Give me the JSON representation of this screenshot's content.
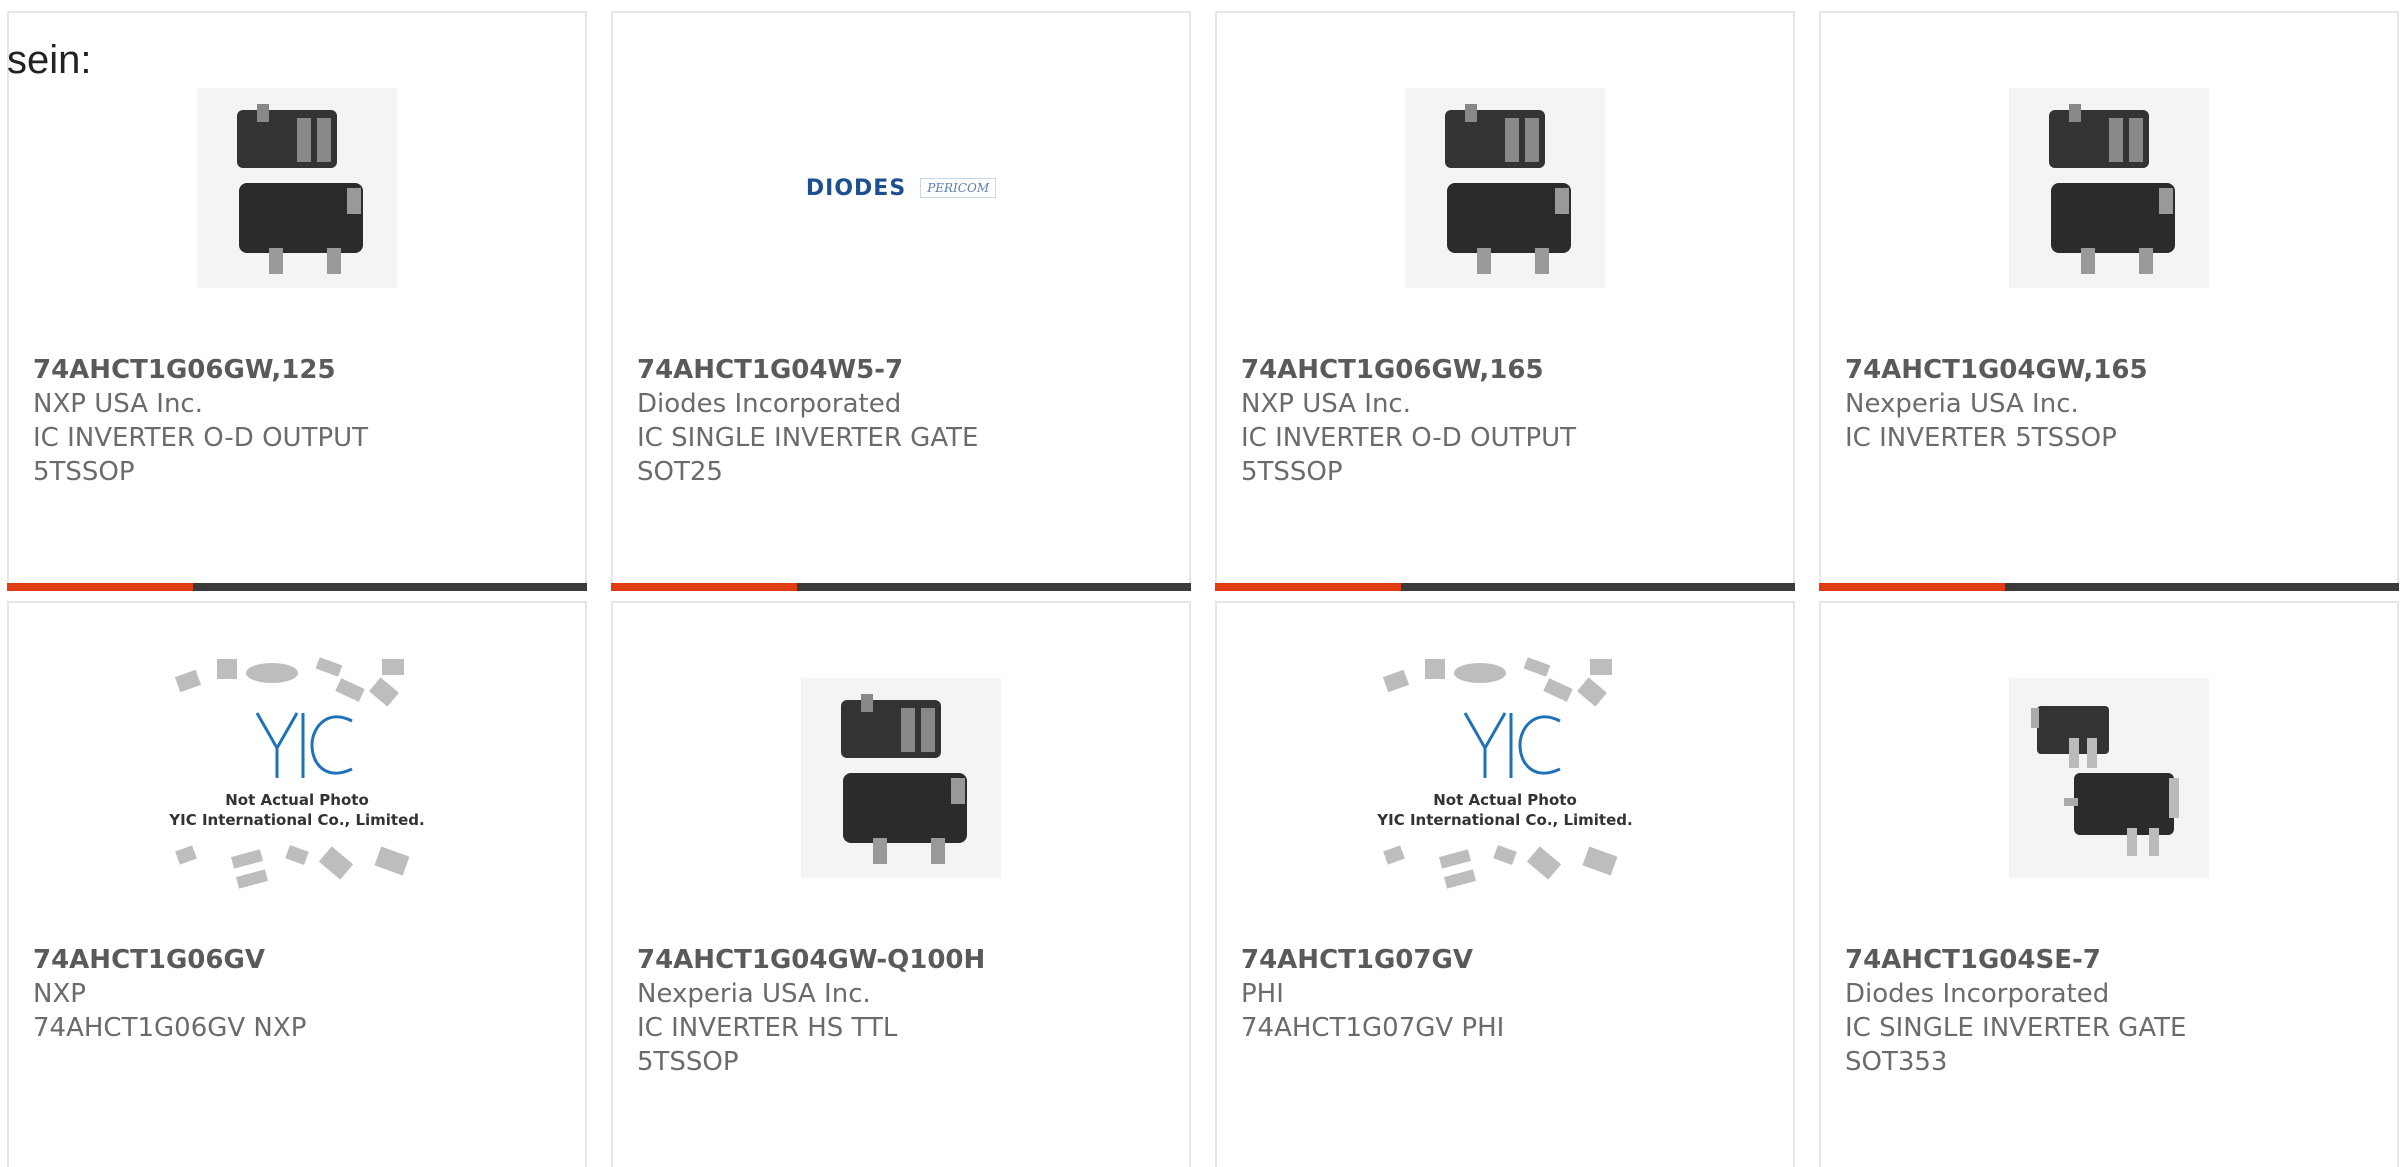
{
  "intro_text": "sein:",
  "colors": {
    "accent": "#e13b12",
    "bar": "#3a3a3a",
    "border": "#e6e6e6",
    "yic_blue": "#1f72b8",
    "diodes_blue": "#1d4e8f"
  },
  "products": [
    {
      "part_number": "74AHCT1G06GW,125",
      "manufacturer": "NXP USA Inc.",
      "description": "IC INVERTER O-D OUTPUT 5TSSOP",
      "image": "chip-sot353-photo"
    },
    {
      "part_number": "74AHCT1G04W5-7",
      "manufacturer": "Diodes Incorporated",
      "description": "IC SINGLE INVERTER GATE SOT25",
      "image": "diodes-pericom-logo",
      "logo_text": "DIODES",
      "logo_text2": "PERICOM"
    },
    {
      "part_number": "74AHCT1G06GW,165",
      "manufacturer": "NXP USA Inc.",
      "description": "IC INVERTER O-D OUTPUT 5TSSOP",
      "image": "chip-sot353-photo"
    },
    {
      "part_number": "74AHCT1G04GW,165",
      "manufacturer": "Nexperia USA Inc.",
      "description": "IC INVERTER 5TSSOP",
      "image": "chip-sot353-photo"
    },
    {
      "part_number": "74AHCT1G06GV",
      "manufacturer": "NXP",
      "description": "74AHCT1G06GV NXP",
      "image": "yic-not-actual-photo",
      "caption_line1": "Not Actual Photo",
      "caption_line2": "YIC International Co., Limited."
    },
    {
      "part_number": "74AHCT1G04GW-Q100H",
      "manufacturer": "Nexperia USA Inc.",
      "description": "IC INVERTER HS TTL 5TSSOP",
      "image": "chip-sot353-photo"
    },
    {
      "part_number": "74AHCT1G07GV",
      "manufacturer": "PHI",
      "description": "74AHCT1G07GV PHI",
      "image": "yic-not-actual-photo",
      "caption_line1": "Not Actual Photo",
      "caption_line2": "YIC International Co., Limited."
    },
    {
      "part_number": "74AHCT1G04SE-7",
      "manufacturer": "Diodes Incorporated",
      "description": "IC SINGLE INVERTER GATE SOT353",
      "image": "chip-sot353-photo-alt"
    }
  ]
}
